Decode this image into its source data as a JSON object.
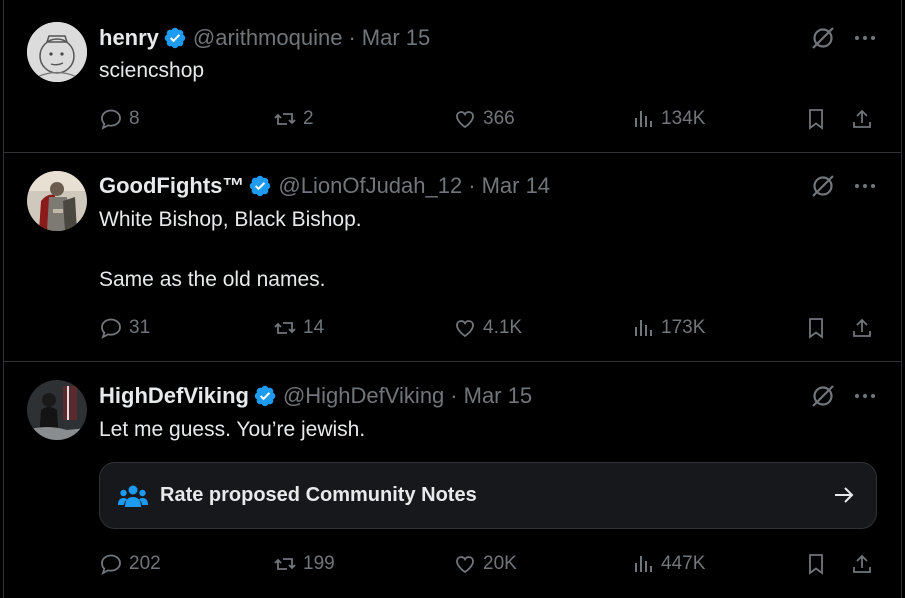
{
  "colors": {
    "background": "#000000",
    "text_primary": "#e7e9ea",
    "text_secondary": "#71767b",
    "verified_blue": "#1d9bf0",
    "divider": "#2f3336"
  },
  "tweets": [
    {
      "name": "henry",
      "handle": "@arithmoquine",
      "separator": "·",
      "date": "Mar 15",
      "text": "sciencshop",
      "replies": "8",
      "retweets": "2",
      "likes": "366",
      "views": "134K",
      "avatar_icon": "sketch-face-avatar"
    },
    {
      "name": "GoodFights™",
      "handle": "@LionOfJudah_12",
      "separator": "·",
      "date": "Mar 14",
      "text": "White Bishop, Black Bishop.\n\nSame as the old names.",
      "replies": "31",
      "retweets": "14",
      "likes": "4.1K",
      "views": "173K",
      "avatar_icon": "knight-avatar"
    },
    {
      "name": "HighDefViking",
      "handle": "@HighDefViking",
      "separator": "·",
      "date": "Mar 15",
      "text": "Let me guess. You’re jewish.",
      "community_notes_label": "Rate proposed Community Notes",
      "replies": "202",
      "retweets": "199",
      "likes": "20K",
      "views": "447K",
      "avatar_icon": "viking-avatar"
    }
  ],
  "icons": {
    "verified": "verified-badge-icon",
    "grok": "grok-icon",
    "more": "more-icon",
    "reply": "reply-icon",
    "retweet": "retweet-icon",
    "like": "heart-icon",
    "views": "views-icon",
    "bookmark": "bookmark-icon",
    "share": "share-icon",
    "community_notes": "people-icon",
    "arrow": "arrow-right-icon"
  }
}
